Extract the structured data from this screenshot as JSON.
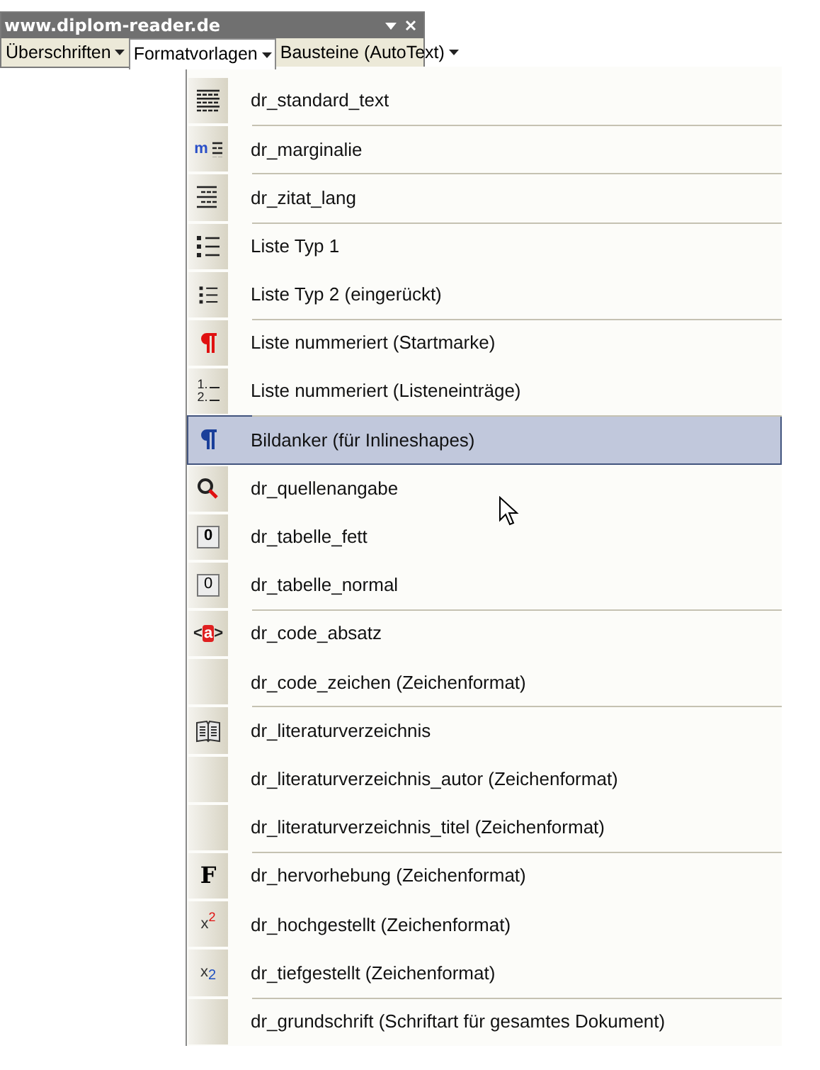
{
  "window": {
    "title": "www.diplom-reader.de"
  },
  "toolbar": [
    {
      "label": "Überschriften",
      "selected": false
    },
    {
      "label": "Formatvorlagen",
      "selected": true
    },
    {
      "label": "Bausteine (AutoText)",
      "selected": false
    }
  ],
  "menu": [
    {
      "kind": "lines",
      "label": "dr_standard_text",
      "separator_before": false,
      "selected": false
    },
    {
      "kind": "marginal",
      "glyph": "m",
      "label": "dr_marginalie",
      "separator_before": true,
      "selected": false
    },
    {
      "kind": "quote",
      "label": "dr_zitat_lang",
      "separator_before": true,
      "selected": false
    },
    {
      "kind": "bullets",
      "label": "Liste Typ 1",
      "separator_before": true,
      "selected": false
    },
    {
      "kind": "bullets-small",
      "label": "Liste Typ 2 (eingerückt)",
      "separator_before": false,
      "selected": false
    },
    {
      "kind": "pilcrow",
      "label": "Liste nummeriert (Startmarke)",
      "separator_before": true,
      "selected": false
    },
    {
      "kind": "numbered",
      "glyph": "1.2.",
      "label": "Liste nummeriert (Listeneinträge)",
      "separator_before": false,
      "selected": false
    },
    {
      "kind": "pilcrow-blue",
      "label": "Bildanker (für Inlineshapes)",
      "separator_before": true,
      "selected": true
    },
    {
      "kind": "magnifier",
      "label": "dr_quellenangabe",
      "separator_before": false,
      "selected": false
    },
    {
      "kind": "box-bold",
      "glyph": "0",
      "label": "dr_tabelle_fett",
      "separator_before": false,
      "selected": false
    },
    {
      "kind": "box",
      "glyph": "0",
      "label": "dr_tabelle_normal",
      "separator_before": false,
      "selected": false
    },
    {
      "kind": "code",
      "glyph": "<a>",
      "label": "dr_code_absatz",
      "separator_before": true,
      "selected": false
    },
    {
      "kind": "none",
      "label": "dr_code_zeichen (Zeichenformat)",
      "separator_before": false,
      "selected": false
    },
    {
      "kind": "book",
      "label": "dr_literaturverzeichnis",
      "separator_before": true,
      "selected": false
    },
    {
      "kind": "none",
      "label": "dr_literaturverzeichnis_autor (Zeichenformat)",
      "separator_before": false,
      "selected": false
    },
    {
      "kind": "none",
      "label": "dr_literaturverzeichnis_titel (Zeichenformat)",
      "separator_before": false,
      "selected": false
    },
    {
      "kind": "bold",
      "glyph": "F",
      "label": "dr_hervorhebung (Zeichenformat)",
      "separator_before": true,
      "selected": false
    },
    {
      "kind": "super",
      "glyph": "x$^{2}$",
      "label": "dr_hochgestellt (Zeichenformat)",
      "separator_before": false,
      "selected": false
    },
    {
      "kind": "sub",
      "glyph": "x$_{2}$",
      "label": "dr_tiefgestellt (Zeichenformat)",
      "separator_before": false,
      "selected": false
    },
    {
      "kind": "none",
      "label": "dr_grundschrift (Schriftart für gesamtes Dokument)",
      "separator_before": true,
      "selected": false
    }
  ]
}
